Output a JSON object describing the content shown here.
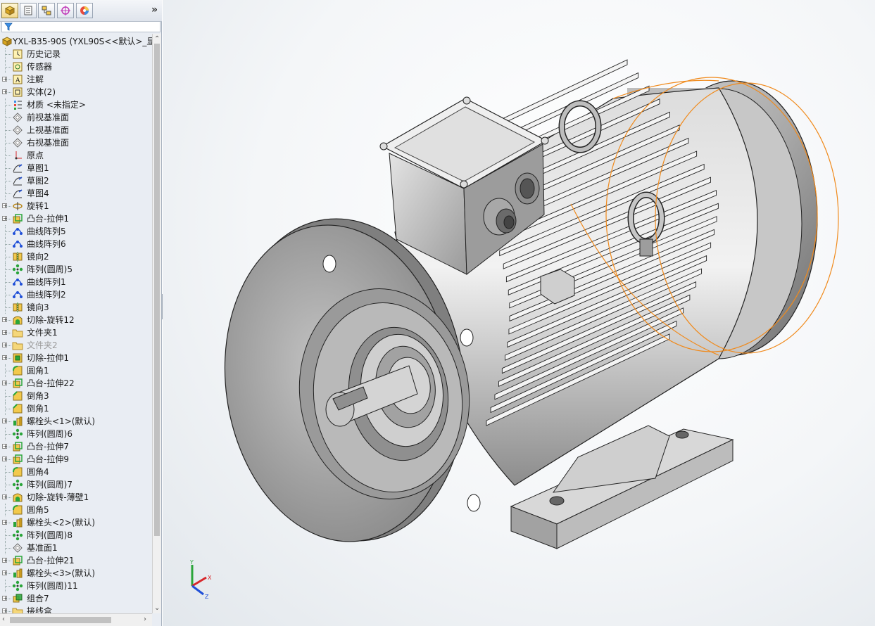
{
  "feature_tree": {
    "root_label": "YXL-B35-90S  (YXL90S<<默认>_显",
    "items": [
      {
        "label": "历史记录",
        "icon": "history-icon",
        "expand": false
      },
      {
        "label": "传感器",
        "icon": "sensor-icon",
        "expand": false
      },
      {
        "label": "注解",
        "icon": "annotation-icon",
        "expand": true
      },
      {
        "label": "实体(2)",
        "icon": "solid-bodies-icon",
        "expand": true
      },
      {
        "label": "材质 <未指定>",
        "icon": "material-icon",
        "expand": false
      },
      {
        "label": "前视基准面",
        "icon": "plane-icon",
        "expand": false
      },
      {
        "label": "上视基准面",
        "icon": "plane-icon",
        "expand": false
      },
      {
        "label": "右视基准面",
        "icon": "plane-icon",
        "expand": false
      },
      {
        "label": "原点",
        "icon": "origin-icon",
        "expand": false
      },
      {
        "label": "草图1",
        "icon": "sketch-icon",
        "expand": false
      },
      {
        "label": "草图2",
        "icon": "sketch-icon",
        "expand": false
      },
      {
        "label": "草图4",
        "icon": "sketch-icon",
        "expand": false
      },
      {
        "label": "旋转1",
        "icon": "revolve-icon",
        "expand": true
      },
      {
        "label": "凸台-拉伸1",
        "icon": "extrude-icon",
        "expand": true
      },
      {
        "label": "曲线阵列5",
        "icon": "curve-pattern-icon",
        "expand": false
      },
      {
        "label": "曲线阵列6",
        "icon": "curve-pattern-icon",
        "expand": false
      },
      {
        "label": "镜向2",
        "icon": "mirror-icon",
        "expand": false
      },
      {
        "label": "阵列(圆周)5",
        "icon": "circular-pattern-icon",
        "expand": false
      },
      {
        "label": "曲线阵列1",
        "icon": "curve-pattern-icon",
        "expand": false
      },
      {
        "label": "曲线阵列2",
        "icon": "curve-pattern-icon",
        "expand": false
      },
      {
        "label": "镜向3",
        "icon": "mirror-icon",
        "expand": false
      },
      {
        "label": "切除-旋转12",
        "icon": "cut-revolve-icon",
        "expand": true
      },
      {
        "label": "文件夹1",
        "icon": "folder-icon",
        "expand": true
      },
      {
        "label": "文件夹2",
        "icon": "folder-icon",
        "expand": true,
        "dim": true
      },
      {
        "label": "切除-拉伸1",
        "icon": "cut-extrude-icon",
        "expand": true
      },
      {
        "label": "圆角1",
        "icon": "fillet-icon",
        "expand": false
      },
      {
        "label": "凸台-拉伸22",
        "icon": "extrude-icon",
        "expand": true
      },
      {
        "label": "倒角3",
        "icon": "chamfer-icon",
        "expand": false
      },
      {
        "label": "倒角1",
        "icon": "chamfer-icon",
        "expand": false
      },
      {
        "label": "螺栓头<1>(默认)",
        "icon": "library-part-icon",
        "expand": true
      },
      {
        "label": "阵列(圆周)6",
        "icon": "circular-pattern-icon",
        "expand": false
      },
      {
        "label": "凸台-拉伸7",
        "icon": "extrude-icon",
        "expand": true
      },
      {
        "label": "凸台-拉伸9",
        "icon": "extrude-icon",
        "expand": true
      },
      {
        "label": "圆角4",
        "icon": "fillet-icon",
        "expand": false
      },
      {
        "label": "阵列(圆周)7",
        "icon": "circular-pattern-icon",
        "expand": false
      },
      {
        "label": "切除-旋转-薄壁1",
        "icon": "cut-revolve-icon",
        "expand": true
      },
      {
        "label": "圆角5",
        "icon": "fillet-icon",
        "expand": false
      },
      {
        "label": "螺栓头<2>(默认)",
        "icon": "library-part-icon",
        "expand": true
      },
      {
        "label": "阵列(圆周)8",
        "icon": "circular-pattern-icon",
        "expand": false
      },
      {
        "label": "基准面1",
        "icon": "plane-icon",
        "expand": false
      },
      {
        "label": "凸台-拉伸21",
        "icon": "extrude-icon",
        "expand": true
      },
      {
        "label": "螺栓头<3>(默认)",
        "icon": "library-part-icon",
        "expand": true
      },
      {
        "label": "阵列(圆周)11",
        "icon": "circular-pattern-icon",
        "expand": false
      },
      {
        "label": "组合7",
        "icon": "combine-icon",
        "expand": true
      },
      {
        "label": "接线盒",
        "icon": "folder-icon",
        "expand": true
      }
    ]
  },
  "tabs": [
    {
      "name": "feature-manager-tab",
      "icon": "feature-manager-icon"
    },
    {
      "name": "property-manager-tab",
      "icon": "property-manager-icon"
    },
    {
      "name": "configuration-manager-tab",
      "icon": "configuration-icon"
    },
    {
      "name": "dimxpert-tab",
      "icon": "dimxpert-icon"
    },
    {
      "name": "display-manager-tab",
      "icon": "display-manager-icon"
    }
  ],
  "more_glyph": "»",
  "triad": {
    "x": "X",
    "y": "Y",
    "z": "Z"
  },
  "colors": {
    "panel_bg": "#e9edf3",
    "selection_edge": "#f08a1c",
    "model_fill": "#b9b9b9",
    "model_dark": "#6f6f6f"
  }
}
